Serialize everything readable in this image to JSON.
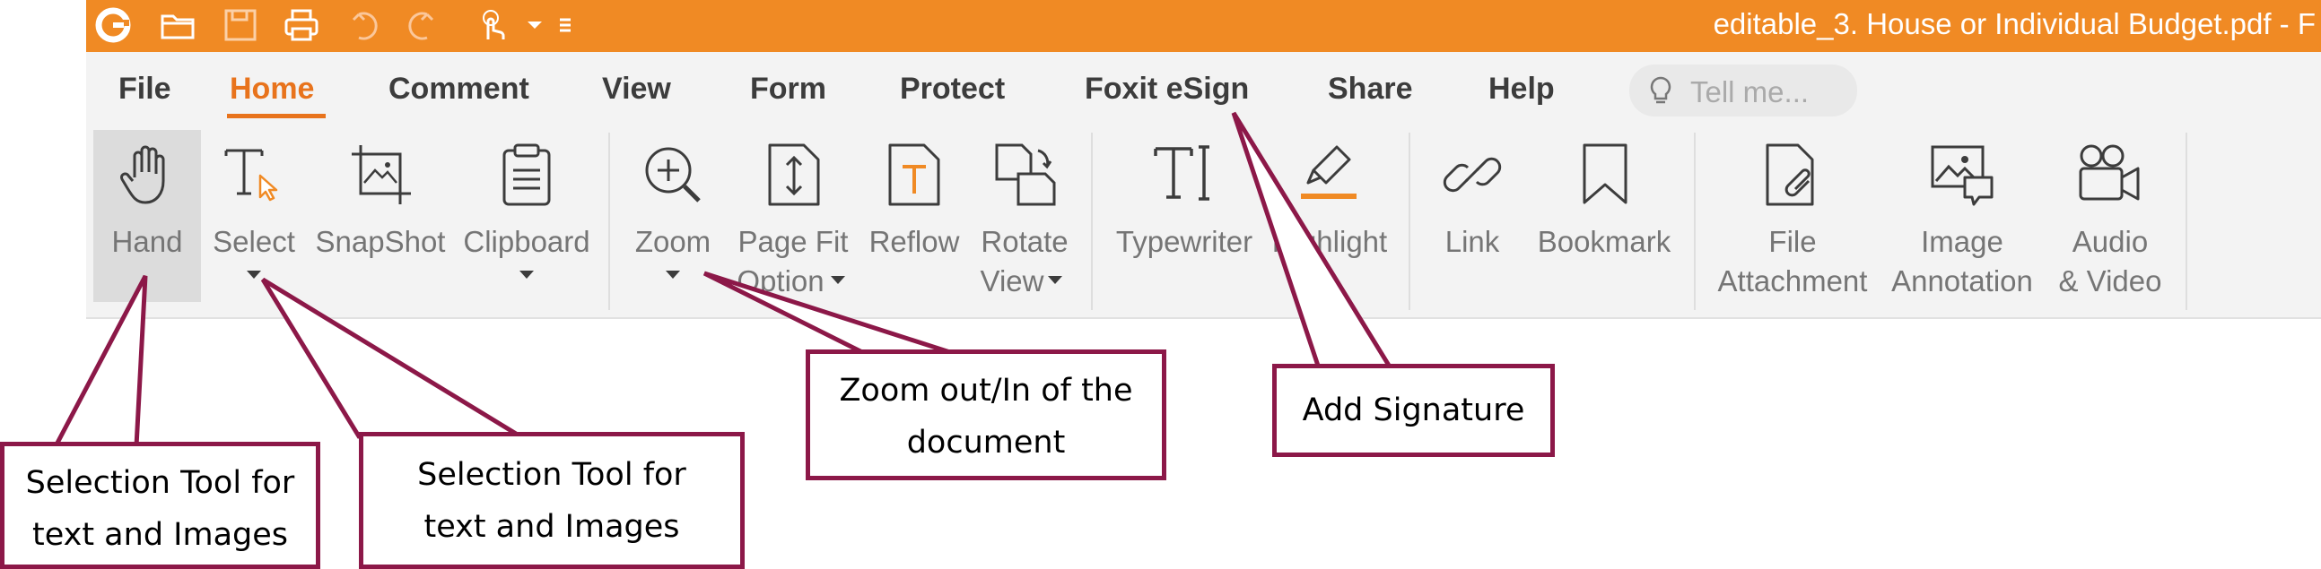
{
  "window": {
    "title": "editable_3. House or Individual Budget.pdf - F",
    "brand_color": "#f08a24",
    "quick_access": [
      "foxit-logo-icon",
      "open-folder-icon",
      "save-icon",
      "print-icon",
      "undo-icon",
      "redo-icon",
      "touch-mode-icon",
      "dropdown-icon",
      "customize-icon"
    ]
  },
  "menu": {
    "tabs": [
      "File",
      "Home",
      "Comment",
      "View",
      "Form",
      "Protect",
      "Foxit eSign",
      "Share",
      "Help"
    ],
    "active_tab": "Home",
    "accent_color": "#e8731c",
    "tell_me_placeholder": "Tell me..."
  },
  "ribbon": {
    "tools": [
      {
        "label": "Hand",
        "icon": "hand-icon"
      },
      {
        "label": "Select",
        "icon": "select-text-icon",
        "dropdown": true
      },
      {
        "label": "SnapShot",
        "icon": "snapshot-icon"
      },
      {
        "label": "Clipboard",
        "icon": "clipboard-icon",
        "dropdown": true
      },
      {
        "label": "Zoom",
        "icon": "zoom-icon",
        "dropdown": true
      },
      {
        "label": "Page Fit",
        "label2": "Option",
        "icon": "page-fit-icon",
        "dropdown": true
      },
      {
        "label": "Reflow",
        "icon": "reflow-icon"
      },
      {
        "label": "Rotate",
        "label2": "View",
        "icon": "rotate-view-icon",
        "dropdown": true
      },
      {
        "label": "Typewriter",
        "icon": "typewriter-icon"
      },
      {
        "label": "Highlight",
        "icon": "highlight-icon"
      },
      {
        "label": "Link",
        "icon": "link-icon"
      },
      {
        "label": "Bookmark",
        "icon": "bookmark-icon"
      },
      {
        "label": "File",
        "label2": "Attachment",
        "icon": "file-attachment-icon"
      },
      {
        "label": "Image",
        "label2": "Annotation",
        "icon": "image-annotation-icon"
      },
      {
        "label": "Audio",
        "label2": "& Video",
        "icon": "audio-video-icon"
      }
    ]
  },
  "annotations": {
    "hand_callout": [
      "Selection Tool for",
      "text and Images"
    ],
    "select_callout": [
      "Selection Tool for",
      "text and Images"
    ],
    "zoom_callout": [
      "Zoom out/In of the",
      "document"
    ],
    "esign_callout": [
      "Add Signature"
    ],
    "border_color": "#8c1848"
  }
}
